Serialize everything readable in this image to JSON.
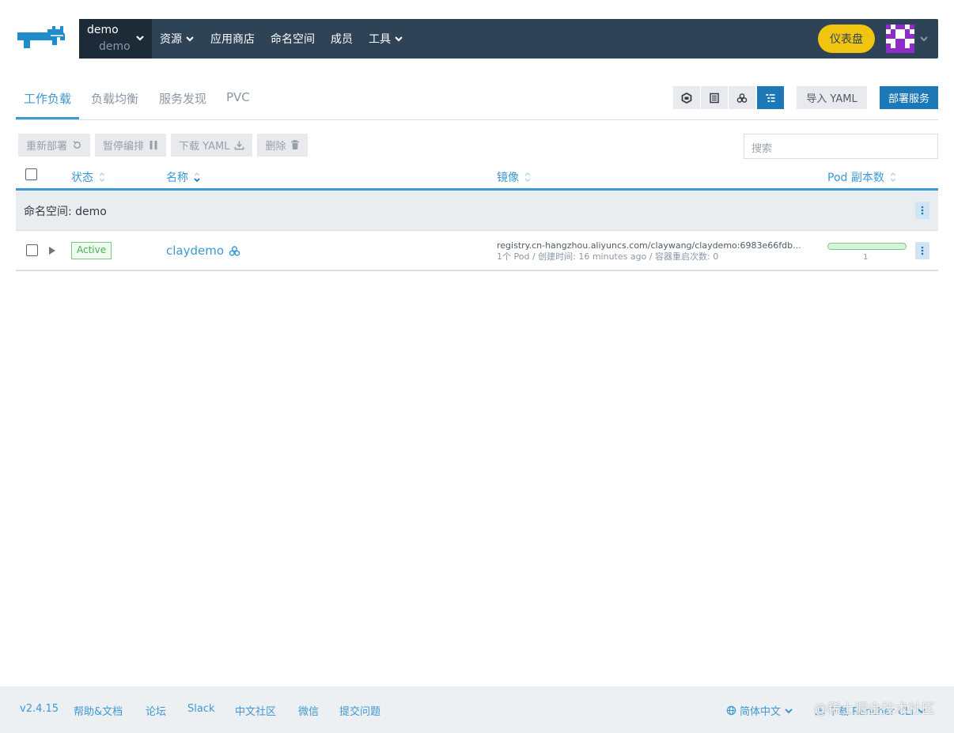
{
  "header": {
    "context_cluster": "demo",
    "context_project": "demo",
    "nav": [
      {
        "label": "资源"
      },
      {
        "label": "应用商店"
      },
      {
        "label": "命名空间"
      },
      {
        "label": "成员"
      },
      {
        "label": "工具"
      }
    ],
    "dashboard_label": "仪表盘"
  },
  "tabs": {
    "items": [
      "工作负载",
      "负载均衡",
      "服务发现",
      "PVC"
    ],
    "active": "工作负载",
    "import_label": "导入 YAML",
    "deploy_label": "部署服务"
  },
  "bulk_actions": {
    "redeploy": "重新部署",
    "pause": "暂停编排",
    "download": "下载 YAML",
    "delete": "删除"
  },
  "search": {
    "placeholder": "搜索"
  },
  "table": {
    "columns": {
      "state": "状态",
      "name": "名称",
      "image": "镜像",
      "pods": "Pod 副本数"
    },
    "group_label": "命名空间: demo",
    "rows": [
      {
        "state": "Active",
        "name": "claydemo",
        "image": "registry.cn-hangzhou.aliyuncs.com/claywang/claydemo:6983e66fdb...",
        "details": "1个 Pod / 创建时间: 16 minutes ago / 容器重启次数: 0",
        "pod_count": "1"
      }
    ]
  },
  "footer": {
    "version": "v2.4.15",
    "links": [
      "帮助&文档",
      "论坛",
      "Slack",
      "中文社区",
      "微信",
      "提交问题"
    ],
    "language": "简体中文",
    "download_cli": "下载 Rancher CLI",
    "watermark": "@稀土掘金技术社区"
  },
  "colors": {
    "nav_bg": "#2f4356",
    "accent": "#3d98d3",
    "primary_button": "#1c78b6",
    "dashboard_button": "#f1c40f",
    "active_green": "#4ab04d"
  }
}
